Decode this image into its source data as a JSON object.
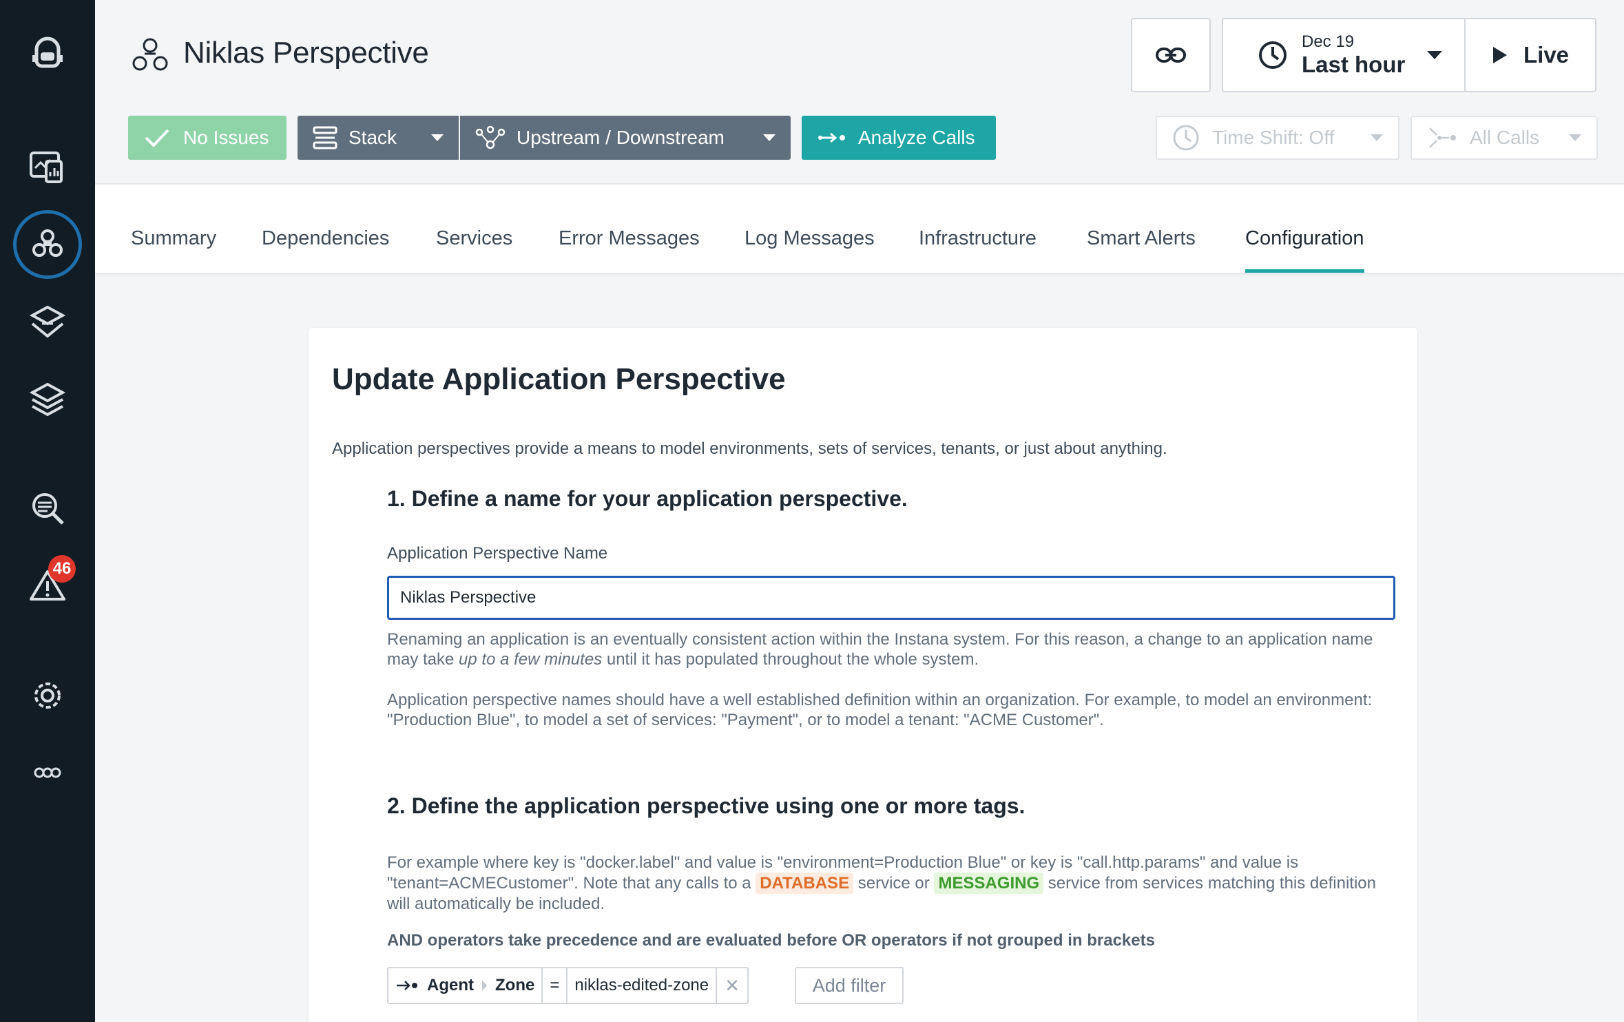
{
  "app": {
    "title": "Niklas Perspective"
  },
  "sidebar": {
    "items": [
      {
        "icon": "robot-logo-icon"
      },
      {
        "icon": "dashboard-icon"
      },
      {
        "icon": "applications-icon"
      },
      {
        "icon": "services-icon"
      },
      {
        "icon": "infrastructure-icon"
      },
      {
        "icon": "analytics-search-icon"
      },
      {
        "icon": "alert-warning-icon"
      },
      {
        "icon": "settings-gear-icon"
      },
      {
        "icon": "more-icon"
      }
    ],
    "alert_badge": "46"
  },
  "header": {
    "time": {
      "date": "Dec 19",
      "range": "Last hour"
    },
    "live_label": "Live",
    "no_issues_label": "No Issues",
    "stack_label": "Stack",
    "upstream_label": "Upstream / Downstream",
    "analyze_label": "Analyze Calls",
    "time_shift_label": "Time Shift: Off",
    "all_calls_label": "All Calls"
  },
  "tabs": [
    {
      "label": "Summary",
      "active": false
    },
    {
      "label": "Dependencies",
      "active": false
    },
    {
      "label": "Services",
      "active": false
    },
    {
      "label": "Error Messages",
      "active": false
    },
    {
      "label": "Log Messages",
      "active": false
    },
    {
      "label": "Infrastructure",
      "active": false
    },
    {
      "label": "Smart Alerts",
      "active": false
    },
    {
      "label": "Configuration",
      "active": true
    }
  ],
  "form": {
    "title": "Update Application Perspective",
    "description": "Application perspectives provide a means to model environments, sets of services, tenants, or just about anything.",
    "step1_title": "1. Define a name for your application perspective.",
    "name_label": "Application Perspective Name",
    "name_value": "Niklas Perspective",
    "help1_a": "Renaming an application is an eventually consistent action within the Instana system. For this reason, a change to an application name may take ",
    "help1_em": "up to a few minutes",
    "help1_b": " until it has populated throughout the whole system.",
    "help2": "Application perspective names should have a well established definition within an organization. For example, to model an environment: \"Production Blue\", to model a set of services: \"Payment\", or to model a tenant: \"ACME Customer\".",
    "step2_title": "2. Define the application perspective using one or more tags.",
    "help3_a": "For example where key is \"docker.label\" and value is \"environment=Production Blue\" or key is \"call.http.params\" and value is \"tenant=ACMECustomer\". Note that any calls to a ",
    "tag_database": "DATABASE",
    "help3_b": " service or ",
    "tag_messaging": "MESSAGING",
    "help3_c": " service from services matching this definition will automatically be included.",
    "and_note": "AND operators take precedence and are evaluated before OR operators if not grouped in brackets",
    "filter": {
      "entity": "Agent",
      "key": "Zone",
      "operator": "=",
      "value": "niklas-edited-zone",
      "remove": "×"
    },
    "add_filter_label": "Add filter"
  },
  "colors": {
    "sidebar_bg": "#121c24",
    "accent_teal": "#1ea5a5",
    "no_issues_green": "#8fd4a9",
    "stack_gray": "#5f6f7d",
    "input_border": "#1f5ab3",
    "badge_red": "#e0362b"
  }
}
